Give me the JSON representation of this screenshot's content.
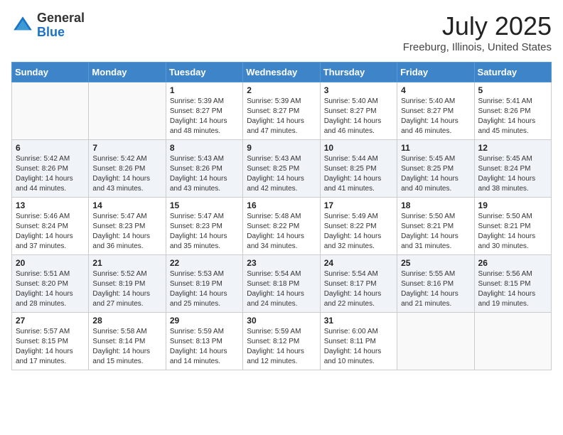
{
  "header": {
    "logo_general": "General",
    "logo_blue": "Blue",
    "month_title": "July 2025",
    "location": "Freeburg, Illinois, United States"
  },
  "weekdays": [
    "Sunday",
    "Monday",
    "Tuesday",
    "Wednesday",
    "Thursday",
    "Friday",
    "Saturday"
  ],
  "weeks": [
    [
      {
        "day": null,
        "sunrise": null,
        "sunset": null,
        "daylight": null
      },
      {
        "day": null,
        "sunrise": null,
        "sunset": null,
        "daylight": null
      },
      {
        "day": "1",
        "sunrise": "Sunrise: 5:39 AM",
        "sunset": "Sunset: 8:27 PM",
        "daylight": "Daylight: 14 hours and 48 minutes."
      },
      {
        "day": "2",
        "sunrise": "Sunrise: 5:39 AM",
        "sunset": "Sunset: 8:27 PM",
        "daylight": "Daylight: 14 hours and 47 minutes."
      },
      {
        "day": "3",
        "sunrise": "Sunrise: 5:40 AM",
        "sunset": "Sunset: 8:27 PM",
        "daylight": "Daylight: 14 hours and 46 minutes."
      },
      {
        "day": "4",
        "sunrise": "Sunrise: 5:40 AM",
        "sunset": "Sunset: 8:27 PM",
        "daylight": "Daylight: 14 hours and 46 minutes."
      },
      {
        "day": "5",
        "sunrise": "Sunrise: 5:41 AM",
        "sunset": "Sunset: 8:26 PM",
        "daylight": "Daylight: 14 hours and 45 minutes."
      }
    ],
    [
      {
        "day": "6",
        "sunrise": "Sunrise: 5:42 AM",
        "sunset": "Sunset: 8:26 PM",
        "daylight": "Daylight: 14 hours and 44 minutes."
      },
      {
        "day": "7",
        "sunrise": "Sunrise: 5:42 AM",
        "sunset": "Sunset: 8:26 PM",
        "daylight": "Daylight: 14 hours and 43 minutes."
      },
      {
        "day": "8",
        "sunrise": "Sunrise: 5:43 AM",
        "sunset": "Sunset: 8:26 PM",
        "daylight": "Daylight: 14 hours and 43 minutes."
      },
      {
        "day": "9",
        "sunrise": "Sunrise: 5:43 AM",
        "sunset": "Sunset: 8:25 PM",
        "daylight": "Daylight: 14 hours and 42 minutes."
      },
      {
        "day": "10",
        "sunrise": "Sunrise: 5:44 AM",
        "sunset": "Sunset: 8:25 PM",
        "daylight": "Daylight: 14 hours and 41 minutes."
      },
      {
        "day": "11",
        "sunrise": "Sunrise: 5:45 AM",
        "sunset": "Sunset: 8:25 PM",
        "daylight": "Daylight: 14 hours and 40 minutes."
      },
      {
        "day": "12",
        "sunrise": "Sunrise: 5:45 AM",
        "sunset": "Sunset: 8:24 PM",
        "daylight": "Daylight: 14 hours and 38 minutes."
      }
    ],
    [
      {
        "day": "13",
        "sunrise": "Sunrise: 5:46 AM",
        "sunset": "Sunset: 8:24 PM",
        "daylight": "Daylight: 14 hours and 37 minutes."
      },
      {
        "day": "14",
        "sunrise": "Sunrise: 5:47 AM",
        "sunset": "Sunset: 8:23 PM",
        "daylight": "Daylight: 14 hours and 36 minutes."
      },
      {
        "day": "15",
        "sunrise": "Sunrise: 5:47 AM",
        "sunset": "Sunset: 8:23 PM",
        "daylight": "Daylight: 14 hours and 35 minutes."
      },
      {
        "day": "16",
        "sunrise": "Sunrise: 5:48 AM",
        "sunset": "Sunset: 8:22 PM",
        "daylight": "Daylight: 14 hours and 34 minutes."
      },
      {
        "day": "17",
        "sunrise": "Sunrise: 5:49 AM",
        "sunset": "Sunset: 8:22 PM",
        "daylight": "Daylight: 14 hours and 32 minutes."
      },
      {
        "day": "18",
        "sunrise": "Sunrise: 5:50 AM",
        "sunset": "Sunset: 8:21 PM",
        "daylight": "Daylight: 14 hours and 31 minutes."
      },
      {
        "day": "19",
        "sunrise": "Sunrise: 5:50 AM",
        "sunset": "Sunset: 8:21 PM",
        "daylight": "Daylight: 14 hours and 30 minutes."
      }
    ],
    [
      {
        "day": "20",
        "sunrise": "Sunrise: 5:51 AM",
        "sunset": "Sunset: 8:20 PM",
        "daylight": "Daylight: 14 hours and 28 minutes."
      },
      {
        "day": "21",
        "sunrise": "Sunrise: 5:52 AM",
        "sunset": "Sunset: 8:19 PM",
        "daylight": "Daylight: 14 hours and 27 minutes."
      },
      {
        "day": "22",
        "sunrise": "Sunrise: 5:53 AM",
        "sunset": "Sunset: 8:19 PM",
        "daylight": "Daylight: 14 hours and 25 minutes."
      },
      {
        "day": "23",
        "sunrise": "Sunrise: 5:54 AM",
        "sunset": "Sunset: 8:18 PM",
        "daylight": "Daylight: 14 hours and 24 minutes."
      },
      {
        "day": "24",
        "sunrise": "Sunrise: 5:54 AM",
        "sunset": "Sunset: 8:17 PM",
        "daylight": "Daylight: 14 hours and 22 minutes."
      },
      {
        "day": "25",
        "sunrise": "Sunrise: 5:55 AM",
        "sunset": "Sunset: 8:16 PM",
        "daylight": "Daylight: 14 hours and 21 minutes."
      },
      {
        "day": "26",
        "sunrise": "Sunrise: 5:56 AM",
        "sunset": "Sunset: 8:15 PM",
        "daylight": "Daylight: 14 hours and 19 minutes."
      }
    ],
    [
      {
        "day": "27",
        "sunrise": "Sunrise: 5:57 AM",
        "sunset": "Sunset: 8:15 PM",
        "daylight": "Daylight: 14 hours and 17 minutes."
      },
      {
        "day": "28",
        "sunrise": "Sunrise: 5:58 AM",
        "sunset": "Sunset: 8:14 PM",
        "daylight": "Daylight: 14 hours and 15 minutes."
      },
      {
        "day": "29",
        "sunrise": "Sunrise: 5:59 AM",
        "sunset": "Sunset: 8:13 PM",
        "daylight": "Daylight: 14 hours and 14 minutes."
      },
      {
        "day": "30",
        "sunrise": "Sunrise: 5:59 AM",
        "sunset": "Sunset: 8:12 PM",
        "daylight": "Daylight: 14 hours and 12 minutes."
      },
      {
        "day": "31",
        "sunrise": "Sunrise: 6:00 AM",
        "sunset": "Sunset: 8:11 PM",
        "daylight": "Daylight: 14 hours and 10 minutes."
      },
      {
        "day": null,
        "sunrise": null,
        "sunset": null,
        "daylight": null
      },
      {
        "day": null,
        "sunrise": null,
        "sunset": null,
        "daylight": null
      }
    ]
  ]
}
